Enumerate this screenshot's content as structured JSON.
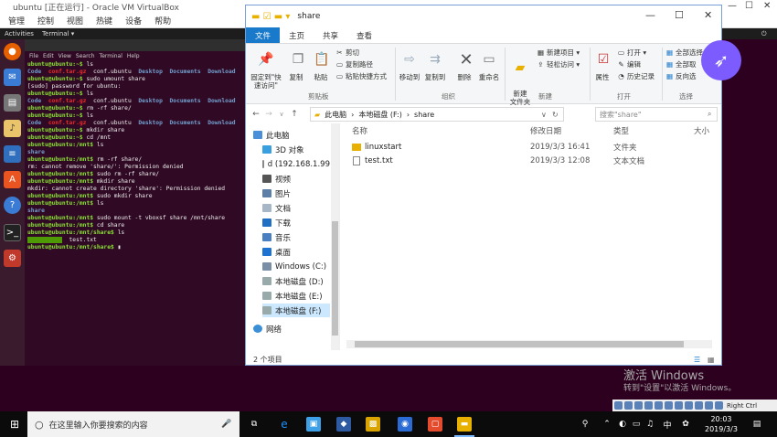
{
  "vbox": {
    "title": "ubuntu [正在运行] - Oracle VM VirtualBox",
    "menu": [
      "管理",
      "控制",
      "视图",
      "热键",
      "设备",
      "帮助"
    ],
    "status_host_key": "Right Ctrl"
  },
  "ubuntu": {
    "activities": "Activities",
    "app_menu": "Terminal ▾"
  },
  "terminal": {
    "menu": [
      "File",
      "Edit",
      "View",
      "Search",
      "Terminal",
      "Help"
    ]
  },
  "explorer": {
    "title": "share",
    "tabs": [
      "文件",
      "主页",
      "共享",
      "查看"
    ],
    "ribbon": {
      "pin_label": "固定到\"快速访问\"",
      "copy": "复制",
      "paste": "粘贴",
      "cut": "剪切",
      "copy_path": "复制路径",
      "paste_shortcut": "粘贴快捷方式",
      "group_clipboard": "剪贴板",
      "move_to": "移动到",
      "copy_to": "复制到",
      "delete": "删除",
      "rename": "重命名",
      "group_organize": "组织",
      "new_folder": "新建\n文件夹",
      "new_item": "新建项目 ▾",
      "easy_access": "轻松访问 ▾",
      "group_new": "新建",
      "properties": "属性",
      "open": "打开 ▾",
      "edit": "编辑",
      "history": "历史记录",
      "group_open": "打开",
      "select_all": "全部选择",
      "select_none": "全部取",
      "invert": "反向选",
      "group_select": "选择"
    },
    "address": [
      "此电脑",
      "›",
      "本地磁盘 (F:)",
      "›",
      "share"
    ],
    "search_placeholder": "搜索\"share\"",
    "nav": [
      "此电脑",
      "3D 对象",
      "d (192.168.1.99",
      "视频",
      "图片",
      "文档",
      "下载",
      "音乐",
      "桌面",
      "Windows (C:)",
      "本地磁盘 (D:)",
      "本地磁盘 (E:)",
      "本地磁盘 (F:)",
      "网络"
    ],
    "columns": {
      "name": "名称",
      "date": "修改日期",
      "type": "类型",
      "size": "大小"
    },
    "files": [
      {
        "name": "linuxstart",
        "date": "2019/3/3 16:41",
        "type": "文件夹"
      },
      {
        "name": "test.txt",
        "date": "2019/3/3 12:08",
        "type": "文本文档"
      }
    ],
    "status": "2 个项目"
  },
  "desktop": {
    "activate_title": "激活 Windows",
    "activate_sub": "转到\"设置\"以激活 Windows。"
  },
  "taskbar": {
    "search_placeholder": "在这里输入你要搜索的内容",
    "ime": "中",
    "time": "20:03",
    "date": "2019/3/3"
  },
  "colors": {
    "accent": "#1979ca",
    "terminal_bg": "#300a24",
    "prompt": "#8ae234",
    "dir": "#729fcf"
  }
}
